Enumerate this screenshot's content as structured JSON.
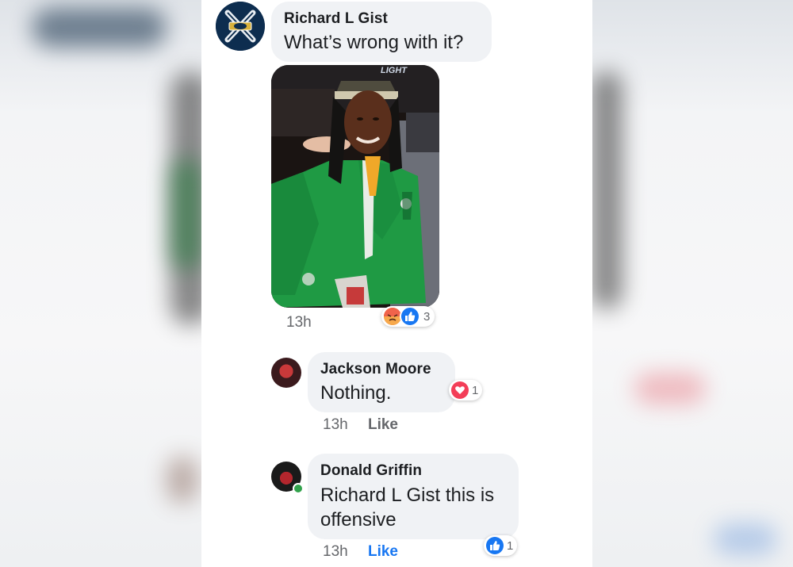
{
  "comments": [
    {
      "author": "Richard L Gist",
      "text": "What’s wrong with it?",
      "time": "13h",
      "photo_badge_text": "LIGHT",
      "reactions": {
        "icons": [
          "angry-icon",
          "like-icon"
        ],
        "count": "3"
      }
    },
    {
      "author": "Jackson Moore",
      "text": "Nothing.",
      "time": "13h",
      "like_label": "Like",
      "reactions": {
        "icons": [
          "love-icon"
        ],
        "count": "1"
      }
    },
    {
      "author": "Donald Griffin",
      "text": "Richard L Gist this is offensive",
      "time": "13h",
      "like_label": "Like",
      "reactions": {
        "icons": [
          "like-icon"
        ],
        "count": "1"
      }
    }
  ],
  "colors": {
    "bubble": "#f0f2f5",
    "like_blue": "#1877f2",
    "love_red": "#f33e58",
    "angry_orange": "#f7714c",
    "meta_gray": "#65676b",
    "online_green": "#31a24c"
  }
}
